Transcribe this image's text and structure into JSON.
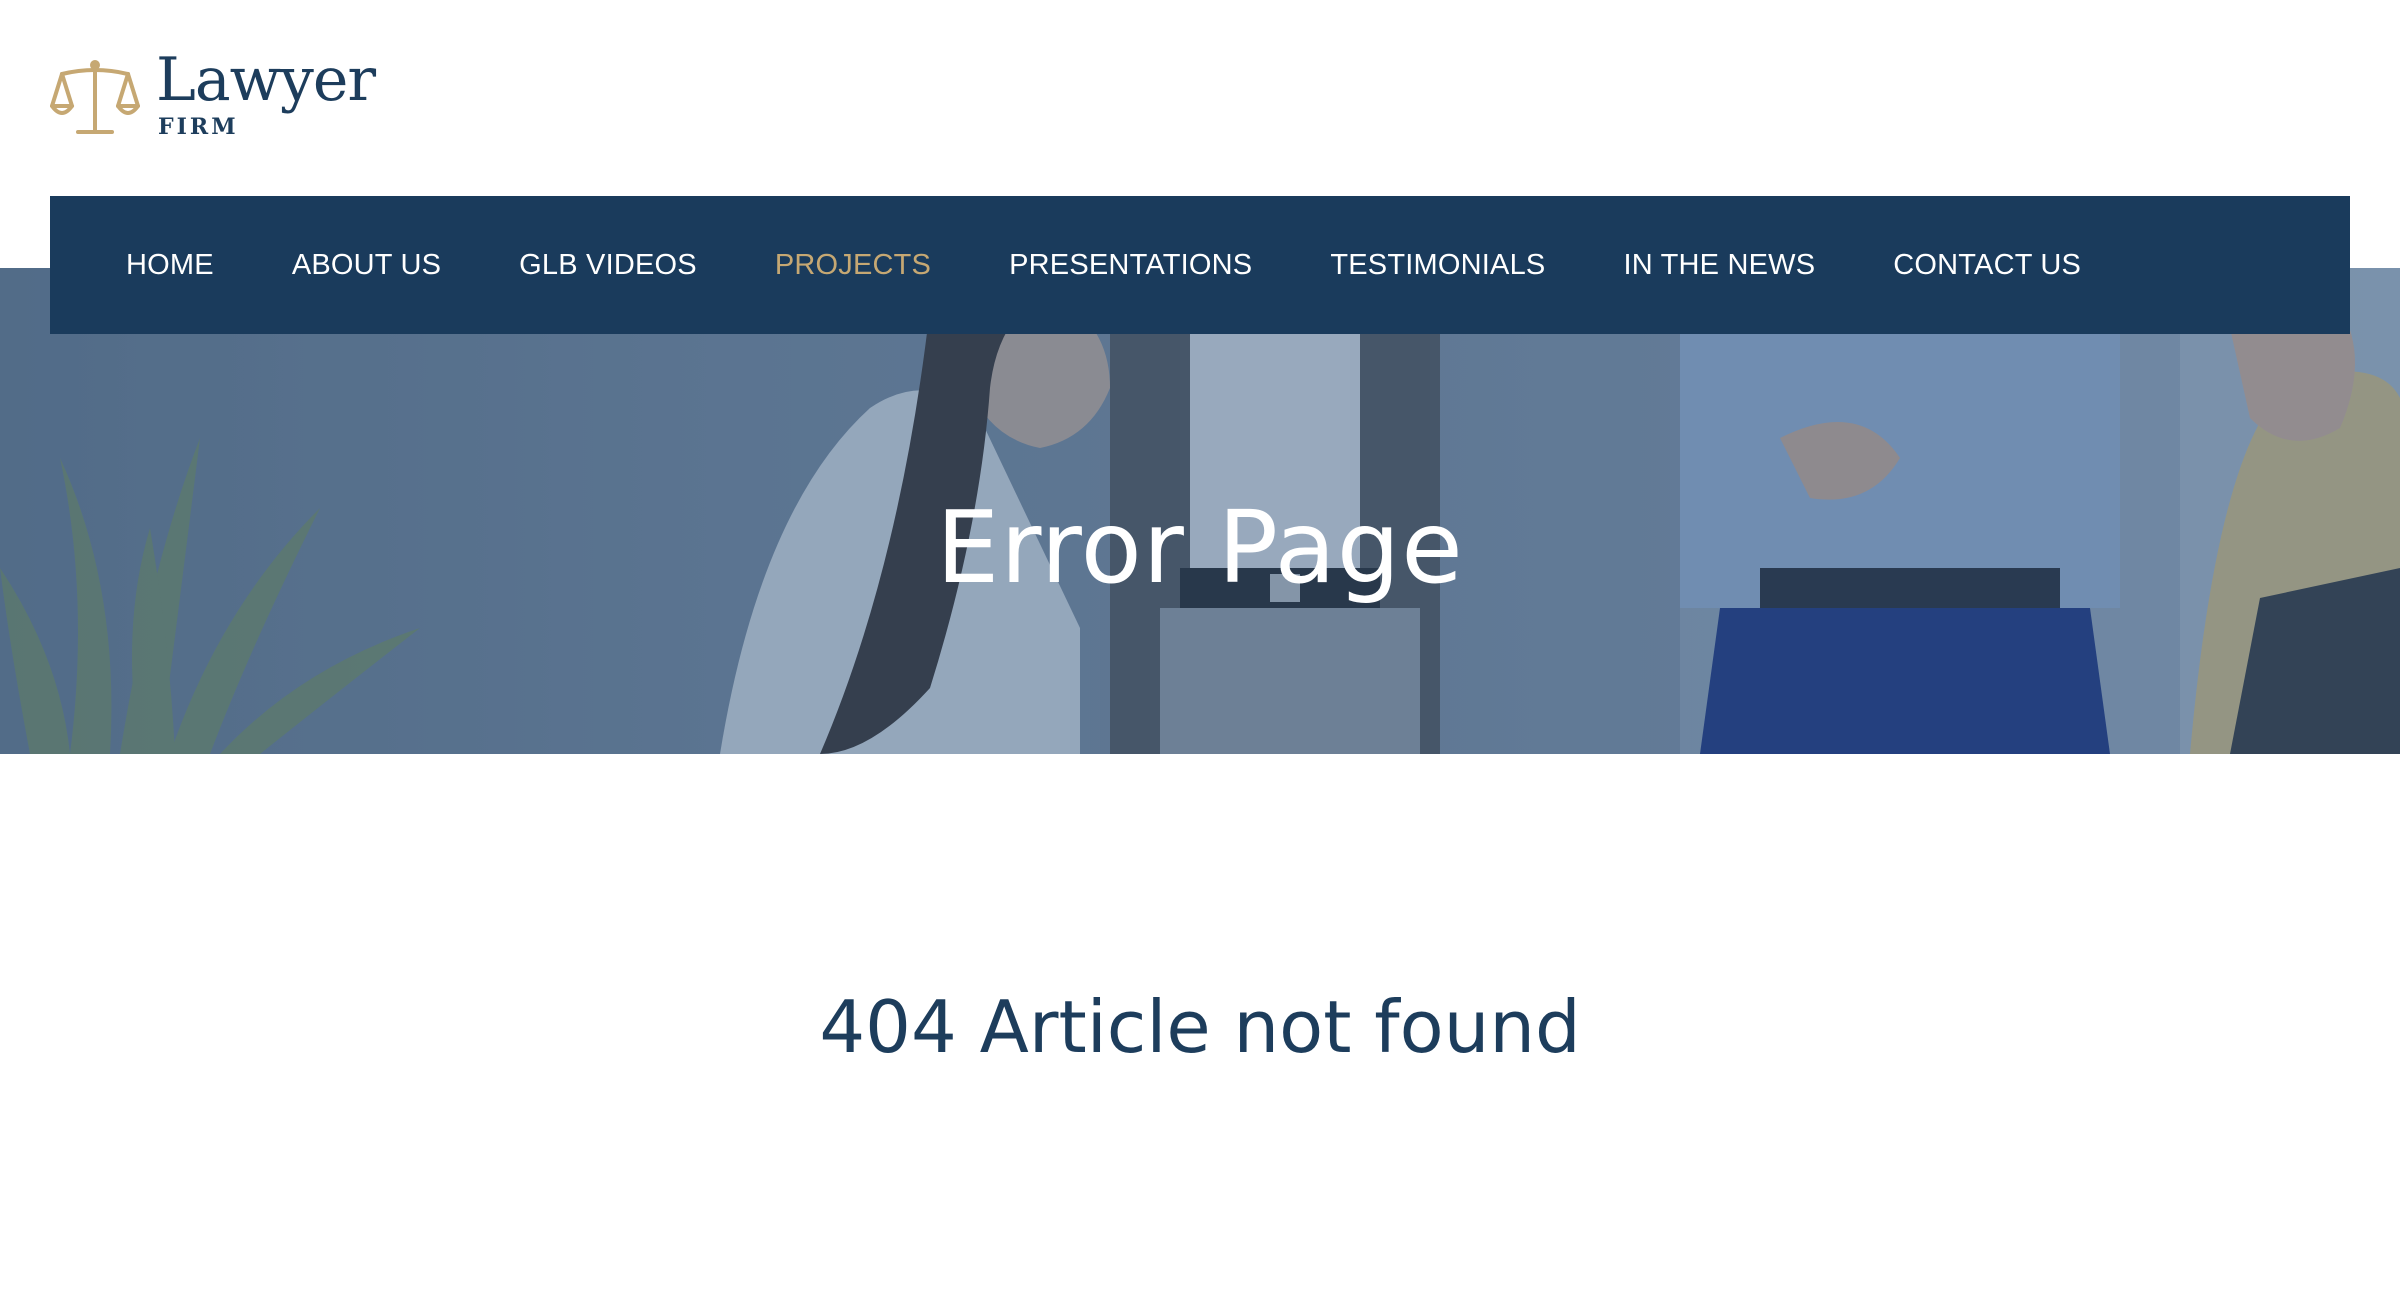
{
  "logo": {
    "name": "Lawyer",
    "subtitle": "FIRM",
    "icon": "scales-of-justice-icon",
    "accent_color": "#c6a873",
    "text_color": "#1d3d5c"
  },
  "nav": {
    "background": "#1a3b5c",
    "items": [
      {
        "label": "HOME",
        "active": false
      },
      {
        "label": "ABOUT US",
        "active": false
      },
      {
        "label": "GLB VIDEOS",
        "active": false
      },
      {
        "label": "PROJECTS",
        "active": true
      },
      {
        "label": "PRESENTATIONS",
        "active": false
      },
      {
        "label": "TESTIMONIALS",
        "active": false
      },
      {
        "label": "IN THE NEWS",
        "active": false
      },
      {
        "label": "CONTACT US",
        "active": false
      }
    ]
  },
  "hero": {
    "title": "Error Page"
  },
  "main": {
    "error_message": "404 Article not found"
  }
}
